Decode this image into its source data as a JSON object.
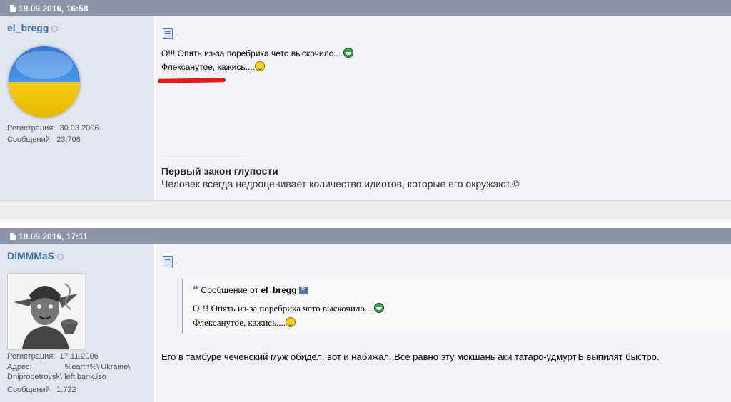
{
  "posts": [
    {
      "date": "19.09.2016, 16:58",
      "username": "el_bregg",
      "avatar_desc": "ukraine-flag-ball",
      "registration_label": "Регистрация:",
      "registration_value": "30.03.2006",
      "messages_label": "Сообщений:",
      "messages_value": "23,706",
      "line1": "О!!! Опять из-за поребрика чето выскочило....",
      "line2": "Флексанутое, кажись....",
      "signature_title": "Первый закон глупости",
      "signature_text": "Человек всегда недооценивает количество идиотов, которые его окружают.©"
    },
    {
      "date": "19.09.2016, 17:11",
      "username": "DiMMMaS",
      "registration_label": "Регистрация:",
      "registration_value": "17.11.2006",
      "address_label": "Адрес:",
      "address_value_1": "%earth%\\ Ukraine\\",
      "address_value_2": "Dnipropetrovsk\\ left bank.iso",
      "messages_label": "Сообщений:",
      "messages_value": "1,722",
      "quote_prefix": "Сообщение от",
      "quote_author": "el_bregg",
      "quote_line1": "О!!! Опять из-за поребрика чето выскочило....",
      "quote_line2": "Флексанутое, кажись....",
      "body": "Его в тамбуре чеченский муж обидел, вот и набижал. Все равно эту мокшань аки татаро-удмуртЪ выпилят быстро."
    }
  ],
  "icons": {
    "post-date": "document-icon",
    "post-message": "message-page-icon",
    "smile-1": "grin-smiley-icon",
    "smile-2": "wink-smiley-icon",
    "quote": "quote-marks-icon",
    "goto": "goto-post-icon"
  },
  "colors": {
    "header_bg": "#8b95a5",
    "userpane_bg": "#e0e5f0",
    "username": "#3d6fa6",
    "message_bg": "#f2f3f6"
  }
}
